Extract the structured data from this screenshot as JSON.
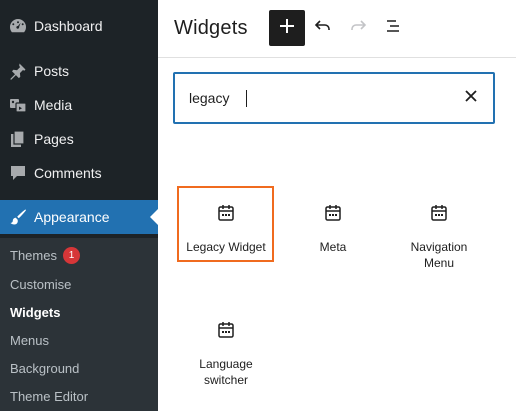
{
  "sidebar": {
    "items": [
      {
        "label": "Dashboard",
        "icon": "dashboard-icon"
      },
      {
        "label": "Posts",
        "icon": "pin-icon"
      },
      {
        "label": "Media",
        "icon": "media-icon"
      },
      {
        "label": "Pages",
        "icon": "pages-icon"
      },
      {
        "label": "Comments",
        "icon": "comment-icon"
      },
      {
        "label": "Appearance",
        "icon": "brush-icon",
        "active": true
      }
    ],
    "submenu": [
      {
        "label": "Themes",
        "badge": "1"
      },
      {
        "label": "Customise"
      },
      {
        "label": "Widgets",
        "current": true
      },
      {
        "label": "Menus"
      },
      {
        "label": "Background"
      },
      {
        "label": "Theme Editor"
      }
    ]
  },
  "header": {
    "title": "Widgets",
    "add_icon": "plus-icon",
    "undo_icon": "undo-icon",
    "redo_icon": "redo-icon",
    "list_view_icon": "list-view-icon"
  },
  "inserter": {
    "search_value": "legacy",
    "clear_icon": "close-icon",
    "results": [
      {
        "label": "Legacy Widget",
        "icon": "calendar-icon",
        "highlighted": true
      },
      {
        "label": "Meta",
        "icon": "calendar-icon"
      },
      {
        "label": "Navigation Menu",
        "icon": "calendar-icon"
      },
      {
        "label": "Language switcher",
        "icon": "calendar-icon"
      }
    ]
  },
  "colors": {
    "sidebar_bg": "#1d2327",
    "submenu_bg": "#2c3338",
    "accent": "#2271b1",
    "badge": "#d63638",
    "highlight": "#f06b1f"
  }
}
